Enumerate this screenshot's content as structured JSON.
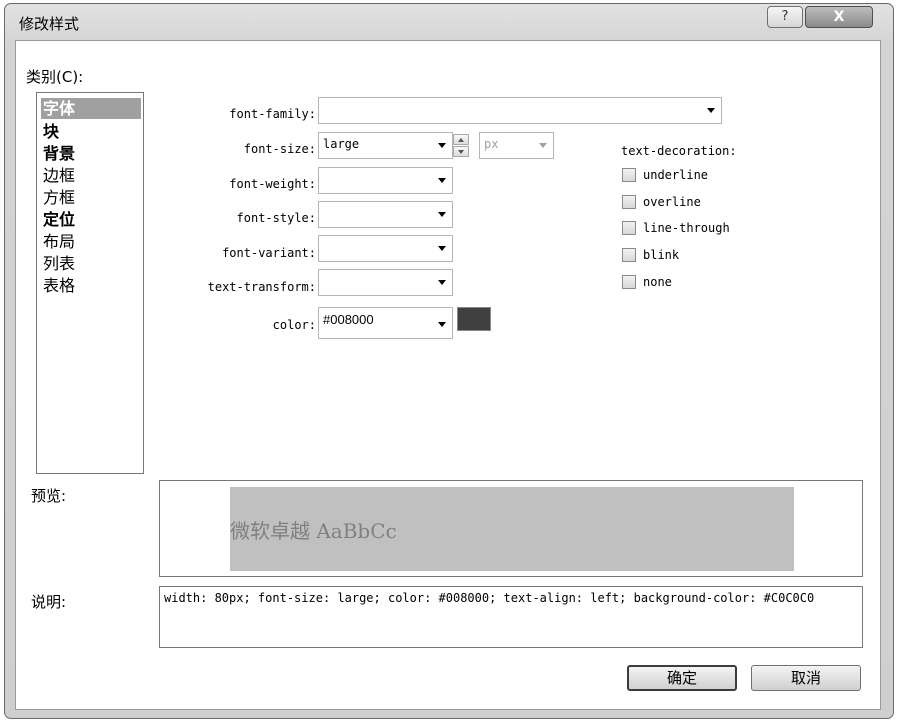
{
  "window": {
    "title": "修改样式",
    "help_label": "?",
    "close_label": "X"
  },
  "category": {
    "label": "类别(C):",
    "items": [
      {
        "label": "字体",
        "style": "selected"
      },
      {
        "label": "块",
        "style": "bold"
      },
      {
        "label": "背景",
        "style": "bold"
      },
      {
        "label": "边框",
        "style": "normal"
      },
      {
        "label": "方框",
        "style": "normal"
      },
      {
        "label": "定位",
        "style": "bold"
      },
      {
        "label": "布局",
        "style": "normal"
      },
      {
        "label": "列表",
        "style": "normal"
      },
      {
        "label": "表格",
        "style": "normal"
      }
    ]
  },
  "props": {
    "font_family": {
      "label": "font-family:",
      "value": ""
    },
    "font_size": {
      "label": "font-size:",
      "value": "large",
      "unit": "px"
    },
    "font_weight": {
      "label": "font-weight:",
      "value": ""
    },
    "font_style": {
      "label": "font-style:",
      "value": ""
    },
    "font_variant": {
      "label": "font-variant:",
      "value": ""
    },
    "text_transform": {
      "label": "text-transform:",
      "value": ""
    },
    "color": {
      "label": "color:",
      "value": "#008000",
      "swatch": "#404040"
    }
  },
  "decoration": {
    "title": "text-decoration:",
    "options": [
      "underline",
      "overline",
      "line-through",
      "blink",
      "none"
    ]
  },
  "preview": {
    "label": "预览:",
    "text": "微软卓越 AaBbCc",
    "bg": "#c0c0c0"
  },
  "description": {
    "label": "说明:",
    "text": "width: 80px; font-size: large; color: #008000; text-align: left; background-color: #C0C0C0"
  },
  "buttons": {
    "ok": "确定",
    "cancel": "取消"
  }
}
